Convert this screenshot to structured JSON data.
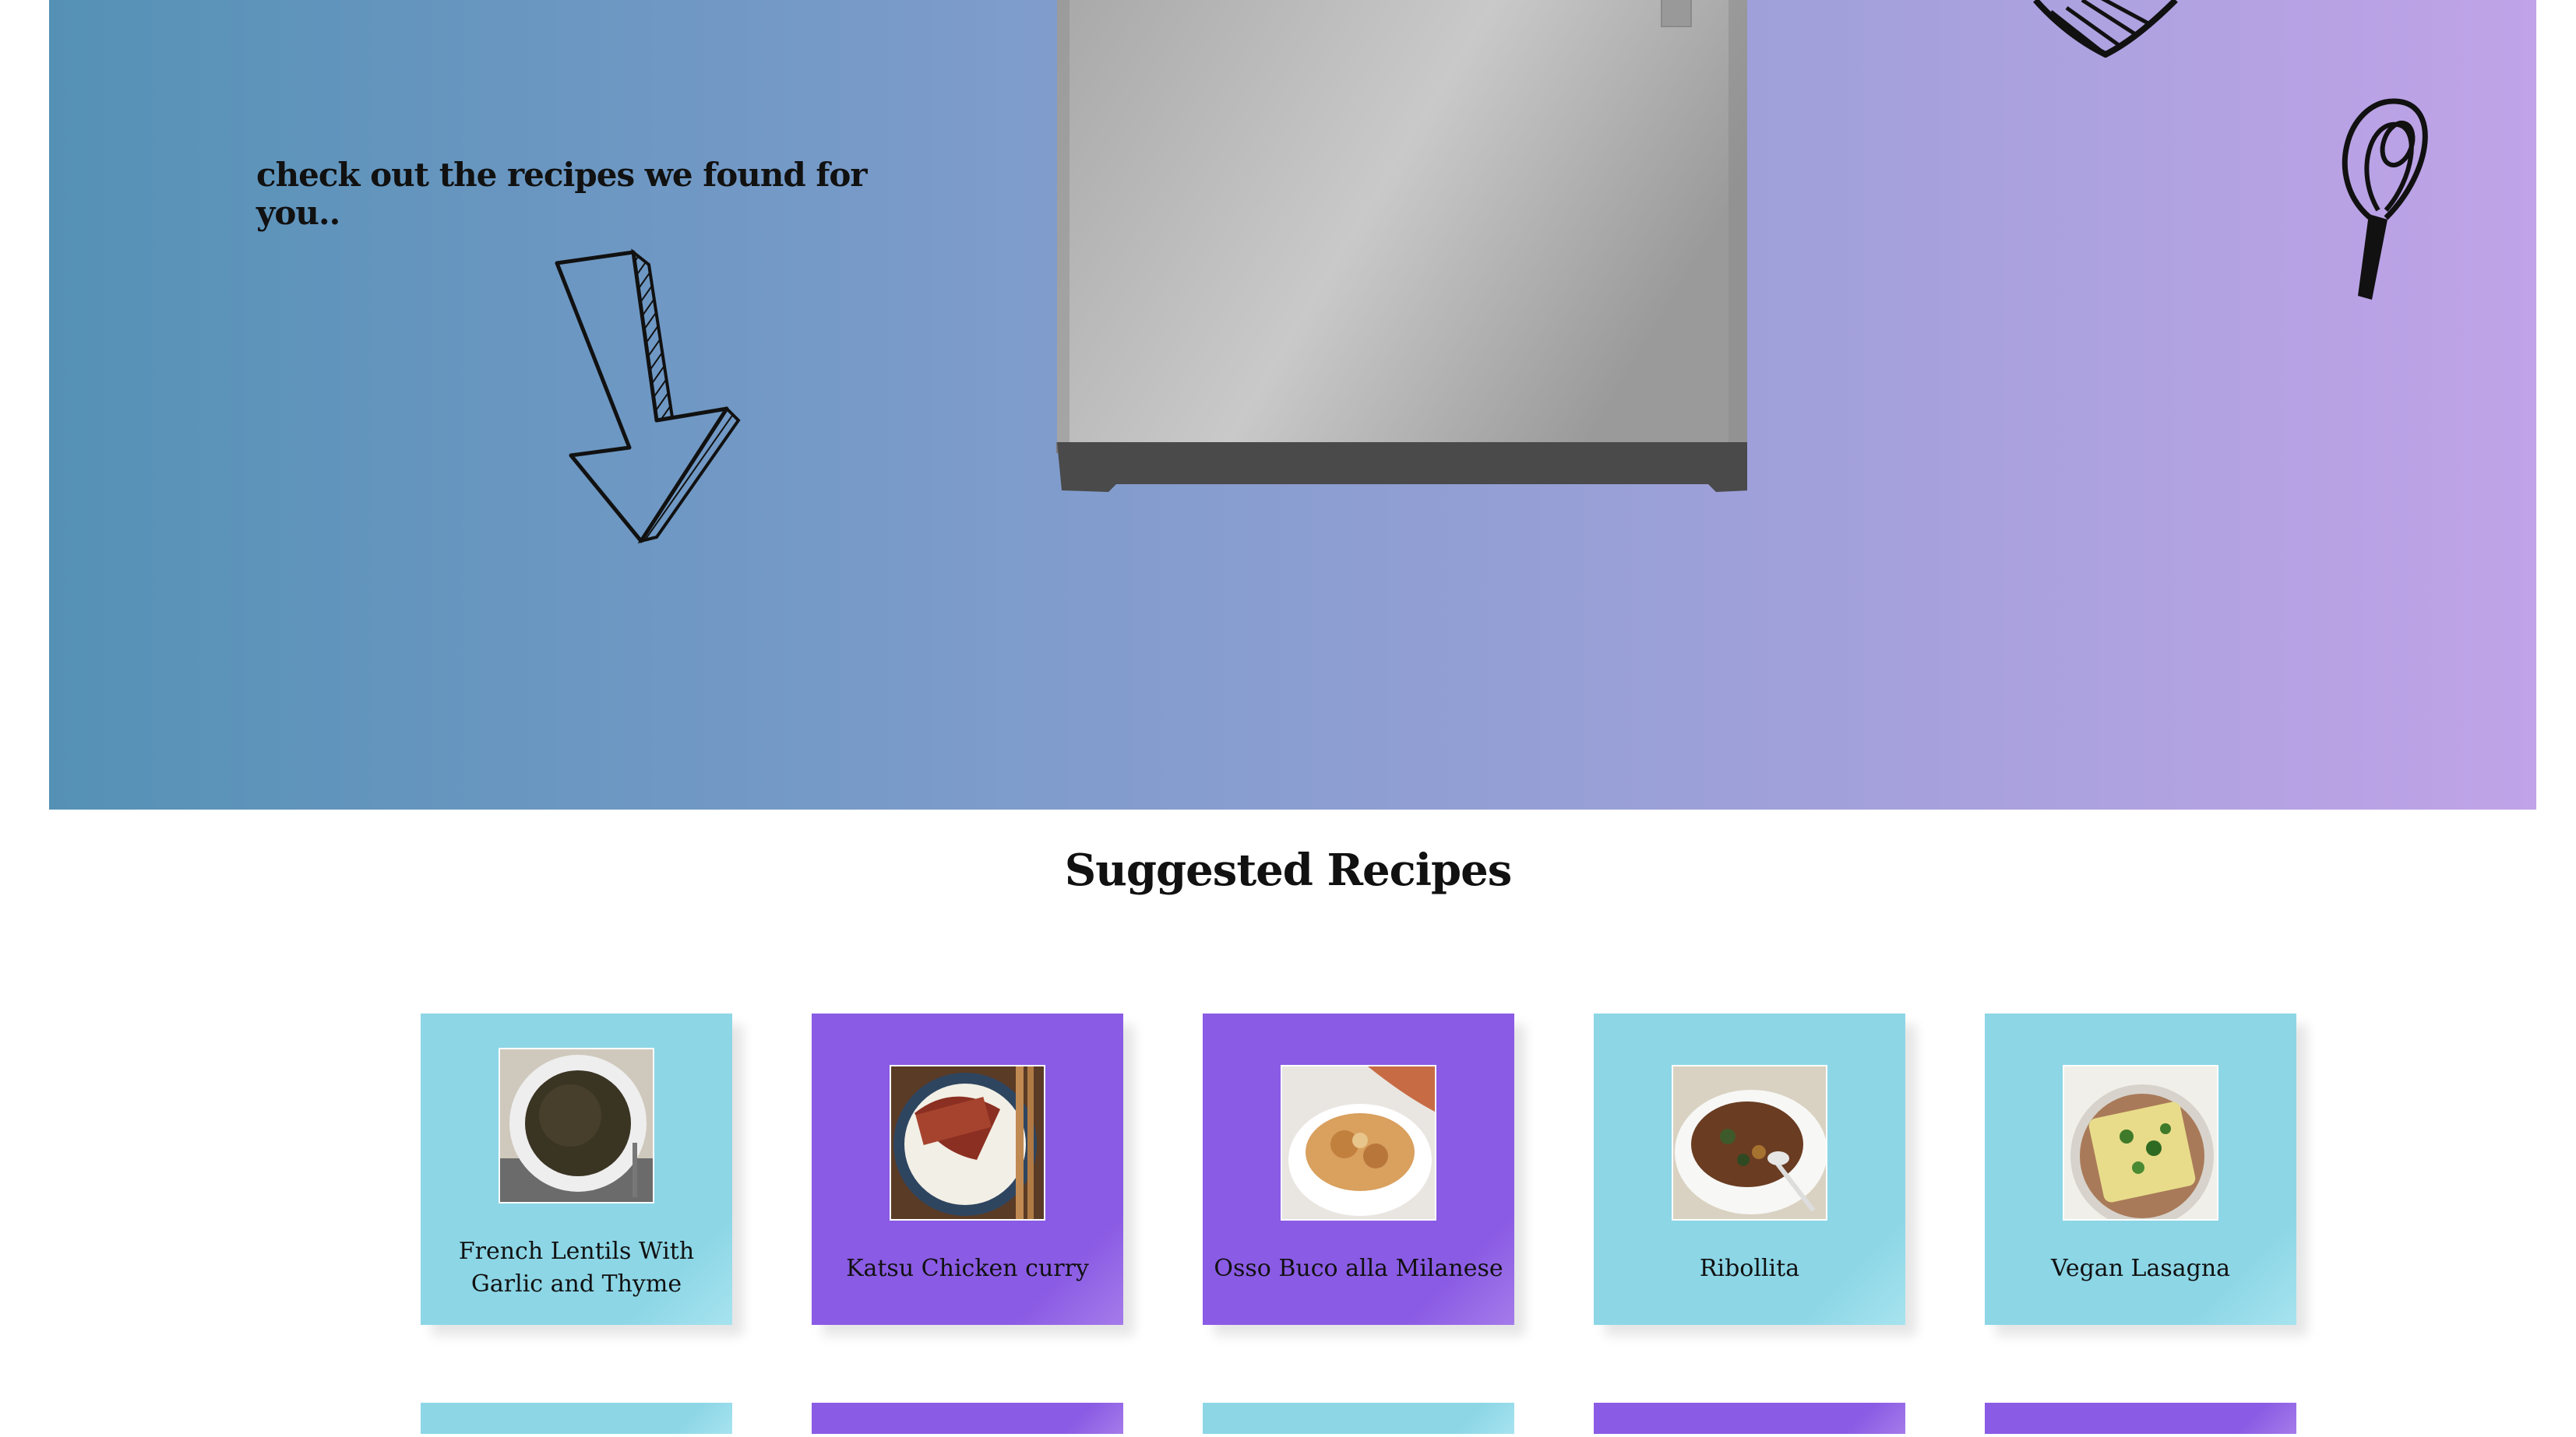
{
  "hero": {
    "tagline": "check out the recipes we found for you.."
  },
  "section": {
    "title": "Suggested Recipes"
  },
  "recipes": [
    {
      "title": "French Lentils With Garlic and Thyme",
      "theme": "blue"
    },
    {
      "title": "Katsu Chicken curry",
      "theme": "purple"
    },
    {
      "title": "Osso Buco alla Milanese",
      "theme": "purple"
    },
    {
      "title": "Ribollita",
      "theme": "blue"
    },
    {
      "title": "Vegan Lasagna",
      "theme": "blue"
    }
  ],
  "colors": {
    "card_blue": "#8cd6e6",
    "card_purple": "#8a5be4",
    "hero_start": "#5591b5",
    "hero_end": "#c0a3e8"
  },
  "icons": [
    "arrow-down-icon",
    "fridge-image",
    "pasta-icon",
    "whisk-icon"
  ]
}
